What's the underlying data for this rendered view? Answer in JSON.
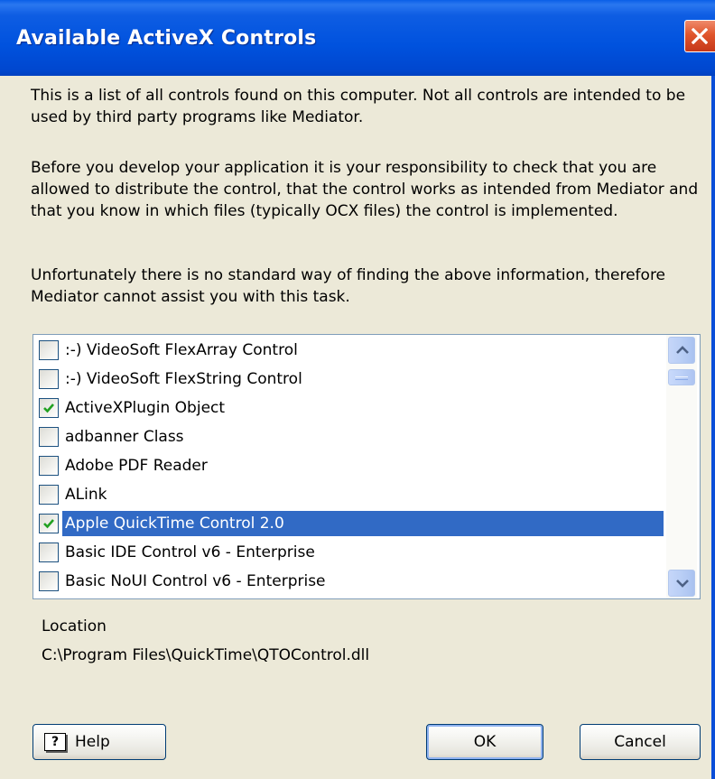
{
  "window": {
    "title": "Available ActiveX Controls"
  },
  "intro": {
    "paragraph1": "This is a list of all controls found on this computer. Not all controls are intended to be used by third party programs like Mediator.",
    "paragraph2": "Before you develop your application it is your responsibility to check that you are allowed to distribute the control, that the control works as intended from Mediator and that you know in which files (typically OCX files) the control is implemented.",
    "paragraph3": "Unfortunately there is no standard way of finding the above information, therefore Mediator cannot assist you with this task."
  },
  "controls": {
    "items": [
      {
        "label": ":-) VideoSoft FlexArray Control",
        "checked": false,
        "selected": false
      },
      {
        "label": ":-) VideoSoft FlexString Control",
        "checked": false,
        "selected": false
      },
      {
        "label": "ActiveXPlugin Object",
        "checked": true,
        "selected": false
      },
      {
        "label": "adbanner Class",
        "checked": false,
        "selected": false
      },
      {
        "label": "Adobe PDF Reader",
        "checked": false,
        "selected": false
      },
      {
        "label": "ALink",
        "checked": false,
        "selected": false
      },
      {
        "label": "Apple QuickTime Control 2.0",
        "checked": true,
        "selected": true
      },
      {
        "label": "Basic IDE Control v6 - Enterprise",
        "checked": false,
        "selected": false
      },
      {
        "label": "Basic NoUI Control v6 - Enterprise",
        "checked": false,
        "selected": false
      }
    ]
  },
  "location": {
    "label": "Location",
    "path": "C:\\Program Files\\QuickTime\\QTOControl.dll"
  },
  "buttons": {
    "help_label": "Help",
    "help_icon_glyph": "?",
    "ok_label": "OK",
    "cancel_label": "Cancel"
  },
  "colors": {
    "title_bar": "#0052de",
    "selection": "#316ac5",
    "dialog_face": "#ece9d8",
    "close_button": "#e0552c",
    "check_mark": "#21a121"
  },
  "icons": {
    "close": "close-icon",
    "check": "checkmark-icon",
    "scroll_up": "chevron-up-icon",
    "scroll_down": "chevron-down-icon",
    "help": "help-book-icon"
  }
}
